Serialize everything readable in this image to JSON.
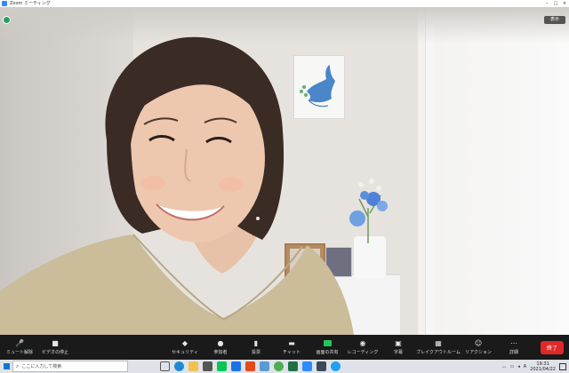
{
  "window": {
    "title": "Zoom ミーティング",
    "minimize": "–",
    "maximize": "□",
    "close": "×"
  },
  "overlay": {
    "view_label": "表示"
  },
  "toolbar": {
    "mute": "ミュート解除",
    "video": "ビデオの停止",
    "security": "セキュリティ",
    "participants": "参加者",
    "participants_count": "1",
    "polls": "投票",
    "chat": "チャット",
    "share": "画面の共有",
    "record": "レコーディング",
    "captions": "字幕",
    "breakout": "ブレイクアウトルーム",
    "reactions": "リアクション",
    "more": "詳細",
    "end": "終了"
  },
  "taskbar": {
    "search_placeholder": "ここに入力して検索",
    "ime": "A",
    "time": "19:31",
    "date": "2021/04/22"
  },
  "colors": {
    "accent": "#2d8cff",
    "end": "#e02828",
    "share": "#23c55a",
    "toolbar_bg": "#1a1a1a"
  }
}
